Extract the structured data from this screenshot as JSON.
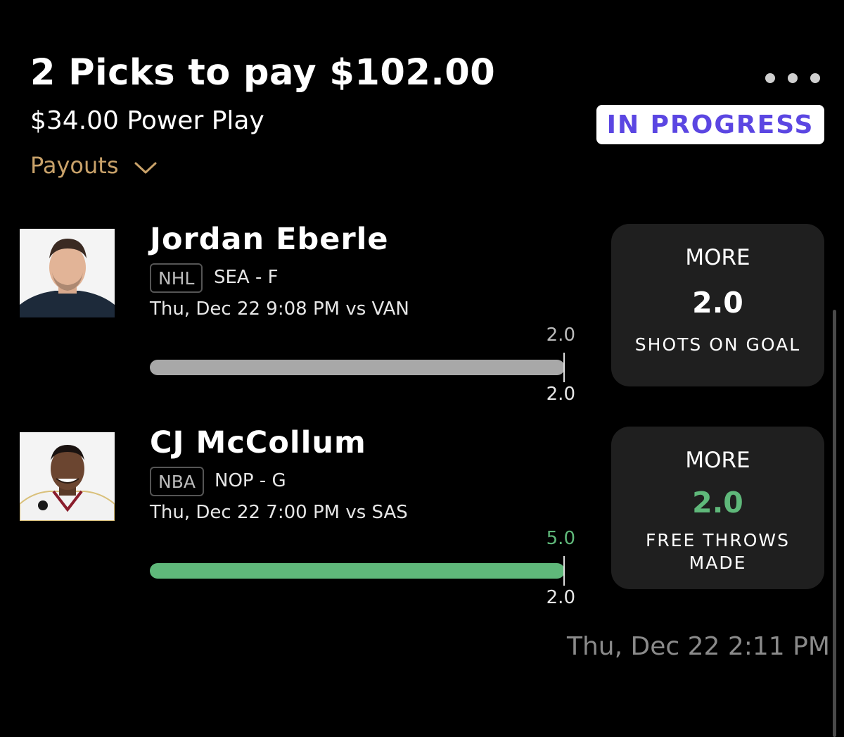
{
  "header": {
    "title": "2 Picks to pay $102.00",
    "subtitle": "$34.00 Power Play",
    "payouts_label": "Payouts",
    "status": "IN PROGRESS"
  },
  "picks": [
    {
      "player": "Jordan Eberle",
      "league": "NHL",
      "team_pos": "SEA - F",
      "game_time": "Thu, Dec 22 9:08 PM  vs VAN",
      "current": "2.0",
      "line": "2.0",
      "direction": "MORE",
      "line_value": "2.0",
      "stat": "SHOTS ON GOAL",
      "progress_fraction": 1.0,
      "bar_color": "#a8a8a8",
      "current_color": "#bbbbbb",
      "line_color": "#ffffff"
    },
    {
      "player": "CJ McCollum",
      "league": "NBA",
      "team_pos": "NOP - G",
      "game_time": "Thu, Dec 22 7:00 PM  vs SAS",
      "current": "5.0",
      "line": "2.0",
      "direction": "MORE",
      "line_value": "2.0",
      "stat": "FREE THROWS MADE",
      "progress_fraction": 1.0,
      "bar_color": "#5fb87a",
      "current_color": "#5fb87a",
      "line_color": "#5fb87a"
    }
  ],
  "timestamp": "Thu, Dec 22 2:11 PM",
  "colors": {
    "accent_gold": "#c9a26a",
    "status_purple": "#5b46e2",
    "card_bg": "#1f1f1f"
  }
}
